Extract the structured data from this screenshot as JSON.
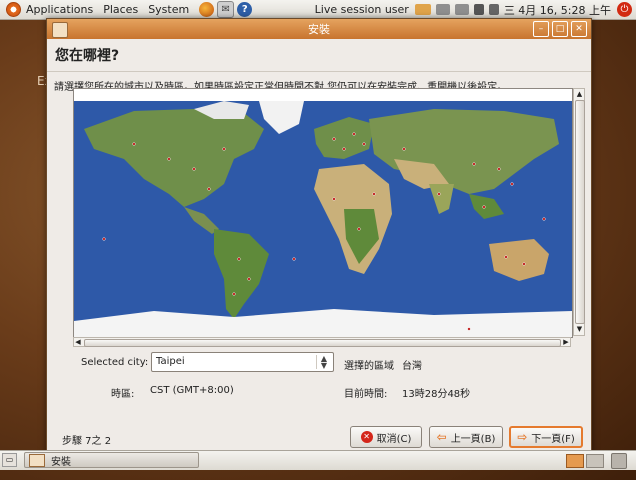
{
  "top_panel": {
    "menus": [
      "Applications",
      "Places",
      "System"
    ],
    "session_label": "Live session user",
    "date_time": "三 4月 16, 5:28 上午"
  },
  "desktop": {
    "partial_label": "Ex"
  },
  "window": {
    "title": "安裝",
    "page_title": "您在哪裡?",
    "instruction": "請選擇您所在的城市以及時區。如果時區設定正常但時間不對,您仍可以在安裝完成、重開機以後設定。",
    "selected_city_label": "Selected city:",
    "selected_city_value": "Taipei",
    "region_label": "選擇的區域",
    "region_value": "台灣",
    "timezone_label": "時區:",
    "timezone_value": "CST (GMT+8:00)",
    "current_time_label": "目前時間:",
    "current_time_value": "13時28分48秒",
    "step_label": "步驟 7之 2",
    "cancel_button": "取消(C)",
    "back_button": "上一頁(B)",
    "forward_button": "下一頁(F)"
  },
  "bottom_panel": {
    "task_label": "安裝"
  },
  "colors": {
    "accent": "#e57a2e",
    "titlebar": "#d88a45",
    "ocean": "#2e59a8",
    "cancel_icon": "#d4261a"
  }
}
